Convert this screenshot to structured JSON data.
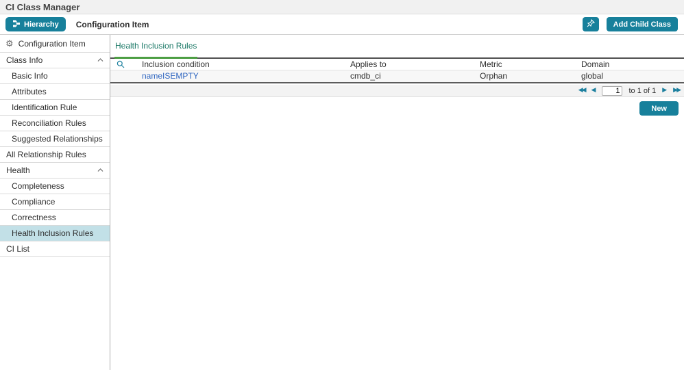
{
  "header": {
    "title": "CI Class Manager"
  },
  "toolbar": {
    "hierarchy_label": "Hierarchy",
    "breadcrumb": "Configuration Item",
    "add_child_class_label": "Add Child Class"
  },
  "sidebar": {
    "root_label": "Configuration Item",
    "items": [
      {
        "label": "Class Info"
      },
      {
        "label": "Basic Info"
      },
      {
        "label": "Attributes"
      },
      {
        "label": "Identification Rule"
      },
      {
        "label": "Reconciliation Rules"
      },
      {
        "label": "Suggested Relationships"
      },
      {
        "label": "All Relationship Rules"
      },
      {
        "label": "Health"
      },
      {
        "label": "Completeness"
      },
      {
        "label": "Compliance"
      },
      {
        "label": "Correctness"
      },
      {
        "label": "Health Inclusion Rules"
      },
      {
        "label": "CI List"
      }
    ],
    "selected_item": "Health Inclusion Rules"
  },
  "main": {
    "active_tab": "Health Inclusion Rules",
    "table": {
      "columns": [
        "Inclusion condition",
        "Applies to",
        "Metric",
        "Domain"
      ],
      "rows": [
        {
          "inclusion_condition": "nameISEMPTY",
          "applies_to": "cmdb_ci",
          "metric": "Orphan",
          "domain": "global"
        }
      ]
    },
    "pagination": {
      "page_value": "1",
      "range_text": "to 1 of 1"
    },
    "new_button_label": "New"
  },
  "colors": {
    "accent_teal": "#17809B",
    "tab_text_teal": "#1D7A68",
    "tab_underline_green": "#4D9E43",
    "link_blue": "#2F66C0",
    "selected_item_bg": "#C2E0E7"
  }
}
